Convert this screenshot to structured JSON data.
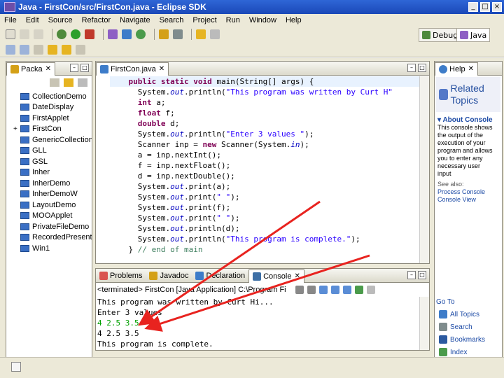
{
  "window": {
    "title": "Java - FirstCon/src/FirstCon.java - Eclipse SDK",
    "controls": [
      "_",
      "□",
      "×"
    ]
  },
  "menu": [
    "File",
    "Edit",
    "Source",
    "Refactor",
    "Navigate",
    "Search",
    "Project",
    "Run",
    "Window",
    "Help"
  ],
  "perspectives": {
    "debug": "Debug",
    "java": "Java"
  },
  "package_explorer": {
    "tab_label": "Packa",
    "items": [
      "CollectionDemo",
      "DateDisplay",
      "FirstApplet",
      "FirstCon",
      "GenericCollection",
      "GLL",
      "GSL",
      "Inher",
      "InherDemo",
      "InherDemoW",
      "LayoutDemo",
      "MOOApplet",
      "PrivateFileDemo",
      "RecordedPresentation",
      "Win1"
    ]
  },
  "editor": {
    "tab_label": "FirstCon.java",
    "lines": [
      [
        {
          "t": "    "
        },
        {
          "t": "public static void",
          "c": "kw"
        },
        {
          "t": " main(String[] args) {"
        }
      ],
      [
        {
          "t": "      System."
        },
        {
          "t": "out",
          "c": "fld"
        },
        {
          "t": ".println("
        },
        {
          "t": "\"This program was written by Curt H\"",
          "c": "st"
        }
      ],
      [
        {
          "t": "      "
        },
        {
          "t": "int",
          "c": "kw"
        },
        {
          "t": " a;"
        }
      ],
      [
        {
          "t": "      "
        },
        {
          "t": "float",
          "c": "kw"
        },
        {
          "t": " f;"
        }
      ],
      [
        {
          "t": "      "
        },
        {
          "t": "double",
          "c": "kw"
        },
        {
          "t": " d;"
        }
      ],
      [
        {
          "t": "      System."
        },
        {
          "t": "out",
          "c": "fld"
        },
        {
          "t": ".println("
        },
        {
          "t": "\"Enter 3 values \"",
          "c": "st"
        },
        {
          "t": ");"
        }
      ],
      [
        {
          "t": "      Scanner inp = "
        },
        {
          "t": "new",
          "c": "kw"
        },
        {
          "t": " Scanner(System."
        },
        {
          "t": "in",
          "c": "fld"
        },
        {
          "t": ");"
        }
      ],
      [
        {
          "t": "      a = inp.nextInt();"
        }
      ],
      [
        {
          "t": "      f = inp.nextFloat();"
        }
      ],
      [
        {
          "t": "      d = inp.nextDouble();"
        }
      ],
      [
        {
          "t": "      System."
        },
        {
          "t": "out",
          "c": "fld"
        },
        {
          "t": ".print(a);"
        }
      ],
      [
        {
          "t": "      System."
        },
        {
          "t": "out",
          "c": "fld"
        },
        {
          "t": ".print("
        },
        {
          "t": "\" \"",
          "c": "st"
        },
        {
          "t": ");"
        }
      ],
      [
        {
          "t": "      System."
        },
        {
          "t": "out",
          "c": "fld"
        },
        {
          "t": ".print(f);"
        }
      ],
      [
        {
          "t": "      System."
        },
        {
          "t": "out",
          "c": "fld"
        },
        {
          "t": ".print("
        },
        {
          "t": "\" \"",
          "c": "st"
        },
        {
          "t": ");"
        }
      ],
      [
        {
          "t": "      System."
        },
        {
          "t": "out",
          "c": "fld"
        },
        {
          "t": ".println(d);"
        }
      ],
      [
        {
          "t": "      System."
        },
        {
          "t": "out",
          "c": "fld"
        },
        {
          "t": ".println("
        },
        {
          "t": "\"This program is complete.\"",
          "c": "st"
        },
        {
          "t": ");"
        }
      ],
      [
        {
          "t": "    } "
        },
        {
          "t": "// end of main",
          "c": "cm"
        }
      ]
    ]
  },
  "bottom_tabs": {
    "problems": "Problems",
    "javadoc": "Javadoc",
    "declaration": "Declaration",
    "console": "Console"
  },
  "console": {
    "header": "<terminated> FirstCon [Java Application] C:\\Program Fi",
    "lines": [
      {
        "text": "This program was written by Curt Hi..."
      },
      {
        "text": "Enter 3 values"
      },
      {
        "text": "4 2.5 3.5",
        "input": true
      },
      {
        "text": "4 2.5 3.5"
      },
      {
        "text": "This program is complete."
      }
    ]
  },
  "help": {
    "tab_label": "Help",
    "related_topics": "Related Topics",
    "about_heading": "About Console",
    "about_text": "This console shows the output of the execution of your program and allows you to enter any necessary user input",
    "see_also": "See also:",
    "links": [
      "Process Console",
      "Console View"
    ],
    "goto": "Go To",
    "footer": [
      "All Topics",
      "Search",
      "Bookmarks",
      "Index"
    ]
  },
  "colors": {
    "arrow": "#e8231f",
    "keyword": "#7f0055",
    "string": "#2a00ff",
    "console_input": "#00a000"
  }
}
